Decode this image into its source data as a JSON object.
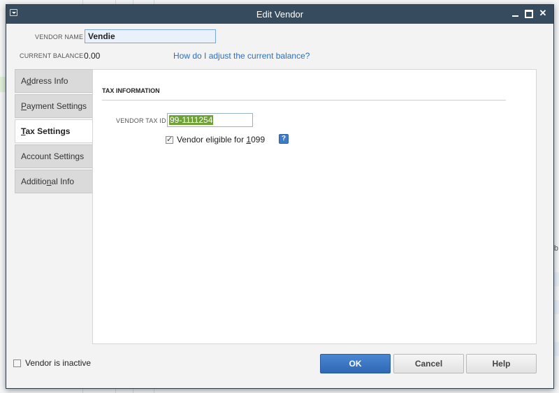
{
  "window": {
    "title": "Edit Vendor"
  },
  "vendor": {
    "name_label": "VENDOR NAME",
    "name_value": "Vendie",
    "balance_label": "CURRENT BALANCE",
    "balance_value": "0.00",
    "adjust_link": "How do I adjust the current balance?"
  },
  "tabs": [
    {
      "pre": "A",
      "u": "d",
      "post": "dress Info"
    },
    {
      "pre": "",
      "u": "P",
      "post": "ayment Settings"
    },
    {
      "pre": "",
      "u": "T",
      "post": "ax Settings"
    },
    {
      "pre": "Account Settin",
      "u": "g",
      "post": "s"
    },
    {
      "pre": "Additio",
      "u": "n",
      "post": "al Info"
    }
  ],
  "tax": {
    "section_title": "TAX INFORMATION",
    "taxid_label": "VENDOR TAX ID",
    "taxid_value": "99-1111254",
    "eligible_pre": "Vendor eligible for ",
    "eligible_u": "1",
    "eligible_post": "099",
    "eligible_checked": true,
    "help_glyph": "?"
  },
  "footer": {
    "inactive_label": "Vendor is inactive",
    "ok": "OK",
    "cancel": "Cancel",
    "help": "Help"
  },
  "background": {
    "edge_text": "b"
  },
  "colors": {
    "titlebar": "#364b5e",
    "ok_button": "#3a78c8",
    "link": "#2f6fb8",
    "selection": "#6fa234"
  }
}
